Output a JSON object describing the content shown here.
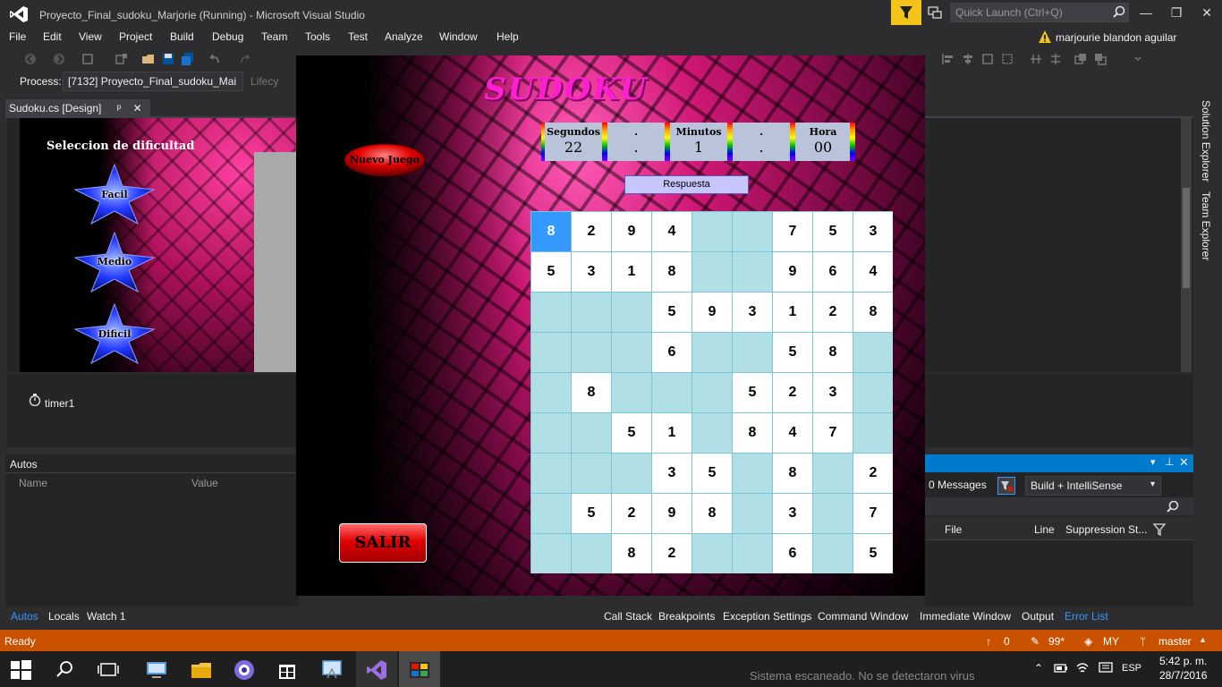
{
  "window": {
    "title": "Proyecto_Final_sudoku_Marjorie (Running) - Microsoft Visual Studio",
    "quick_launch_placeholder": "Quick Launch (Ctrl+Q)",
    "user": "marjourie blandon aguilar",
    "min": "—",
    "max": "❐",
    "close": "✕"
  },
  "menu": [
    "File",
    "Edit",
    "View",
    "Project",
    "Build",
    "Debug",
    "Team",
    "Tools",
    "Test",
    "Analyze",
    "Window",
    "Help"
  ],
  "toolbar": {
    "process_label": "Process:",
    "process_value": "[7132] Proyecto_Final_sudoku_Mai",
    "lifecycle": "Lifecy"
  },
  "document_tab": {
    "label": "Sudoku.cs [Design]",
    "pin": "ᵖ",
    "close": "✕"
  },
  "designer": {
    "difficulty_title": "Seleccion de dificultad",
    "levels": [
      "Facil",
      "Medio",
      "Dificil"
    ],
    "component": "timer1"
  },
  "side_tabs": [
    "Solution Explorer",
    "Team Explorer"
  ],
  "autos": {
    "title": "Autos",
    "columns": [
      "Name",
      "Value"
    ]
  },
  "bottom_tabs_left": [
    {
      "label": "Autos",
      "active": true
    },
    {
      "label": "Locals",
      "active": false
    },
    {
      "label": "Watch 1",
      "active": false
    }
  ],
  "bottom_tabs_right": [
    {
      "label": "Call Stack",
      "active": false
    },
    {
      "label": "Breakpoints",
      "active": false
    },
    {
      "label": "Exception Settings",
      "active": false
    },
    {
      "label": "Command Window",
      "active": false
    },
    {
      "label": "Immediate Window",
      "active": false
    },
    {
      "label": "Output",
      "active": false
    },
    {
      "label": "Error List",
      "active": true
    }
  ],
  "error_list": {
    "messages": "0 Messages",
    "build_filter": "Build + IntelliSense",
    "columns": [
      "File",
      "Line",
      "Suppression St..."
    ]
  },
  "status": {
    "text": "Ready",
    "up_count": "0",
    "pencil_count": "99*",
    "branch_repo": "MY",
    "branch": "master"
  },
  "taskbar": {
    "notification": "Sistema escaneado. No se detectaron virus",
    "language": "ESP",
    "time": "5:42 p. m.",
    "date": "28/7/2016"
  },
  "sudoku": {
    "title": "SUDOKU",
    "timer": [
      {
        "label": "Segundos",
        "value": "22"
      },
      {
        "label": ".",
        "value": "."
      },
      {
        "label": "Minutos",
        "value": "1"
      },
      {
        "label": ".",
        "value": "."
      },
      {
        "label": "Hora",
        "value": "00"
      }
    ],
    "respuesta": "Respuesta",
    "nuevo_juego": "Nuevo Juego",
    "salir": "SALIR",
    "selected_cell": [
      0,
      0
    ],
    "grid": [
      [
        "8",
        "2",
        "9",
        "4",
        "",
        "",
        "7",
        "5",
        "3"
      ],
      [
        "5",
        "3",
        "1",
        "8",
        "",
        "",
        "9",
        "6",
        "4"
      ],
      [
        "",
        "",
        "",
        "5",
        "9",
        "3",
        "1",
        "2",
        "8"
      ],
      [
        "",
        "",
        "",
        "6",
        "",
        "",
        "5",
        "8",
        ""
      ],
      [
        "",
        "8",
        "",
        "",
        "",
        "5",
        "2",
        "3",
        ""
      ],
      [
        "",
        "",
        "5",
        "1",
        "",
        "8",
        "4",
        "7",
        ""
      ],
      [
        "",
        "",
        "",
        "3",
        "5",
        "",
        "8",
        "",
        "2"
      ],
      [
        "",
        "5",
        "2",
        "9",
        "8",
        "",
        "3",
        "",
        "7"
      ],
      [
        "",
        "",
        "8",
        "2",
        "",
        "",
        "6",
        "",
        "5"
      ]
    ]
  },
  "colors": {
    "status_bar": "#ca5100",
    "accent": "#007acc",
    "sudoku_title": "#ff1fd0",
    "cell_empty": "#b0e0e6",
    "cell_selected": "#3399ff"
  }
}
